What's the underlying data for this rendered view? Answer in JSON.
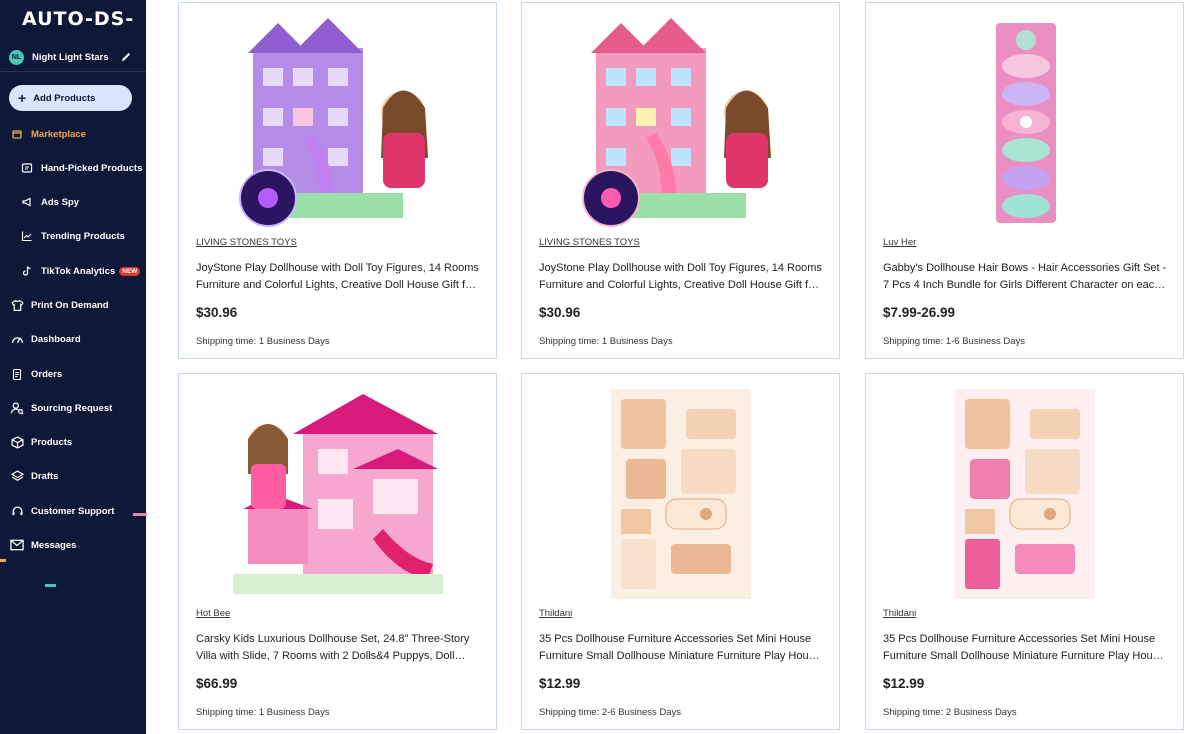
{
  "sidebar": {
    "logo": "AUTO-DS-",
    "store": {
      "initials": "NL",
      "name": "Night Light Stars"
    },
    "add_button": "Add Products",
    "items": [
      {
        "label": "Marketplace",
        "icon": "marketplace-icon",
        "active": true
      },
      {
        "label": "Hand-Picked Products",
        "icon": "hand-picked-icon"
      },
      {
        "label": "Ads Spy",
        "icon": "megaphone-icon"
      },
      {
        "label": "Trending Products",
        "icon": "trending-chart-icon"
      },
      {
        "label": "TikTok Analytics",
        "icon": "tiktok-icon",
        "badge": "NEW"
      },
      {
        "label": "Print On Demand",
        "icon": "shirt-icon"
      },
      {
        "label": "Dashboard",
        "icon": "gauge-icon"
      },
      {
        "label": "Orders",
        "icon": "orders-icon"
      },
      {
        "label": "Sourcing Request",
        "icon": "sourcing-icon"
      },
      {
        "label": "Products",
        "icon": "box-icon"
      },
      {
        "label": "Drafts",
        "icon": "drafts-icon"
      },
      {
        "label": "Customer Support",
        "icon": "headset-icon"
      },
      {
        "label": "Messages",
        "icon": "mail-icon"
      }
    ]
  },
  "products": [
    {
      "brand": "LIVING STONES TOYS",
      "title": "JoyStone Play Dollhouse with Doll Toy Figures, 14 Rooms Furniture and Colorful Lights, Creative Doll House Gift for Kids",
      "price": "$30.96",
      "shipping": "Shipping time: 1 Business Days",
      "image": "purple-dollhouse"
    },
    {
      "brand": "LIVING STONES TOYS",
      "title": "JoyStone Play Dollhouse with Doll Toy Figures, 14 Rooms Furniture and Colorful Lights, Creative Doll House Gift for Kids",
      "price": "$30.96",
      "shipping": "Shipping time: 1 Business Days",
      "image": "pink-dollhouse"
    },
    {
      "brand": "Luv Her",
      "title": "Gabby's Dollhouse Hair Bows - Hair Accessories Gift Set - 7 Pcs 4 Inch Bundle for Girls Different Character on each Hair Bow",
      "price": "$7.99-26.99",
      "shipping": "Shipping time: 1-6 Business Days",
      "image": "hair-bows"
    },
    {
      "brand": "Hot Bee",
      "title": "Carsky Kids Luxurious Dollhouse Set, 24.8\" Three-Story Villa with Slide, 7 Rooms with 2 Dolls&4 Puppys, Doll House Furniture",
      "price": "$66.99",
      "shipping": "Shipping time: 1 Business Days",
      "image": "villa-dollhouse"
    },
    {
      "brand": "Thildani",
      "title": "35 Pcs Dollhouse Furniture Accessories Set Mini House Furniture Small Dollhouse Miniature Furniture Play House Toys",
      "price": "$12.99",
      "shipping": "Shipping time: 2-6 Business Days",
      "image": "furniture-set-beige"
    },
    {
      "brand": "Thildani",
      "title": "35 Pcs Dollhouse Furniture Accessories Set Mini House Furniture Small Dollhouse Miniature Furniture Play House Toys",
      "price": "$12.99",
      "shipping": "Shipping time: 2 Business Days",
      "image": "furniture-set-pink"
    }
  ]
}
